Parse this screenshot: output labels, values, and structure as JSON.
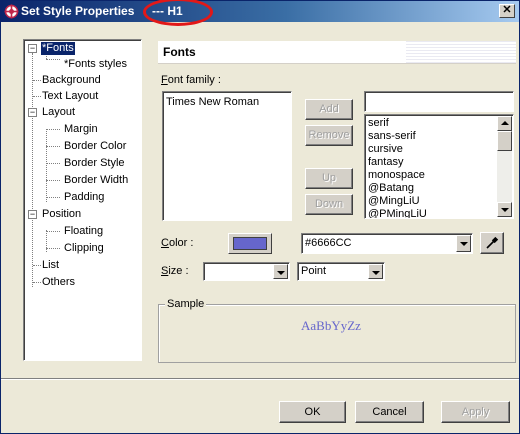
{
  "window": {
    "title": "Set Style Properties",
    "title_suffix": "--- H1",
    "close_label": "✕",
    "highlight_color": "#e21818"
  },
  "tree": {
    "nodes": [
      {
        "label": "*Fonts",
        "selected": true
      },
      {
        "label": "*Fonts styles"
      },
      {
        "label": "Background"
      },
      {
        "label": "Text Layout"
      },
      {
        "label": "Layout"
      },
      {
        "label": "Margin"
      },
      {
        "label": "Border Color"
      },
      {
        "label": "Border Style"
      },
      {
        "label": "Border Width"
      },
      {
        "label": "Padding"
      },
      {
        "label": "Position"
      },
      {
        "label": "Floating"
      },
      {
        "label": "Clipping"
      },
      {
        "label": "List"
      },
      {
        "label": "Others"
      }
    ],
    "expander_minus": "−"
  },
  "panel": {
    "title": "Fonts",
    "font_family_label": "Font family :",
    "font_family_mnemonic": "F",
    "font_family_rest": "ont family :",
    "selected_families": [
      "Times New Roman"
    ],
    "family_input_value": "",
    "available_families": [
      "serif",
      "sans-serif",
      "cursive",
      "fantasy",
      "monospace",
      "@Batang",
      "@MingLiU",
      "@PMingLiU"
    ],
    "buttons": {
      "add": "Add",
      "remove": "Remove",
      "up": "Up",
      "down": "Down"
    },
    "color_label": "Color :",
    "color_mnemonic": "C",
    "color_rest": "olor :",
    "color_value": "#6666CC",
    "color_swatch": "#6666cc",
    "size_label": "Size :",
    "size_mnemonic": "S",
    "size_rest": "ize :",
    "size_value": "",
    "size_unit": "Point",
    "sample_label": "Sample",
    "sample_text": "AaBbYyZz"
  },
  "footer": {
    "ok": "OK",
    "cancel": "Cancel",
    "apply": "Apply"
  },
  "icons": {
    "app": "gear-globe-icon",
    "eyedropper": "eyedropper-icon"
  }
}
